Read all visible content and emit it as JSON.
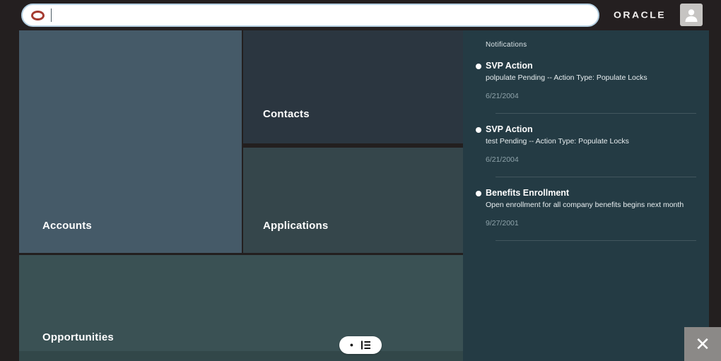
{
  "topbar": {
    "brand": "ORACLE",
    "search": {
      "value": "",
      "placeholder": ""
    }
  },
  "tiles": [
    {
      "label": "Accounts"
    },
    {
      "label": "Contacts"
    },
    {
      "label": "Applications"
    },
    {
      "label": "Opportunities"
    }
  ],
  "notifications": {
    "header": "Notifications",
    "items": [
      {
        "title": "SVP Action",
        "description": "polpulate Pending -- Action Type: Populate Locks",
        "date": "6/21/2004"
      },
      {
        "title": "SVP Action",
        "description": "test Pending -- Action Type: Populate Locks",
        "date": "6/21/2004"
      },
      {
        "title": "Benefits Enrollment",
        "description": "Open enrollment for all company benefits begins next month",
        "date": "9/27/2001"
      }
    ]
  },
  "footer": {
    "page_dot_glyph": "●",
    "close_glyph": "✕"
  },
  "colors": {
    "topbar_bg": "#241f20",
    "oracle_red": "#a53b30",
    "search_border": "#b5d0e2",
    "tile_accounts": "#455a68",
    "tile_contacts": "#2b3640",
    "tile_applications": "#35464b",
    "tile_opportunities": "#3a5154",
    "notifications_panel_bg": "#243b44",
    "side_strip": "#231f1f",
    "close_button_bg": "#8b8987"
  }
}
